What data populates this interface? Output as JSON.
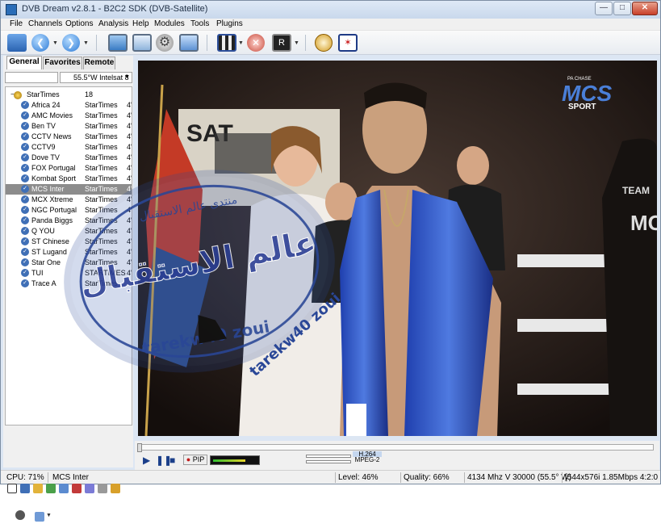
{
  "window": {
    "title": "DVB Dream v2.8.1 - B2C2 SDK (DVB-Satellite)",
    "minimize": "—",
    "maximize": "□",
    "close": "✕"
  },
  "menu": [
    "File",
    "Channels",
    "Options",
    "Analysis",
    "Help",
    "Modules",
    "Tools",
    "Plugins"
  ],
  "toolbar": {
    "icons": [
      "folder-open-icon",
      "back-icon",
      "forward-icon",
      "monitor-icon",
      "window-icon",
      "settings-gears-icon",
      "screen-icon",
      "clapperboard-icon",
      "record-stop-icon",
      "tv-output-icon",
      "timer-clock-icon",
      "radar-icon"
    ]
  },
  "tabs": [
    "General",
    "Favorites",
    "Remote"
  ],
  "satellite": {
    "selected": "55.5°W Intelsat 8"
  },
  "channel_list": {
    "group": {
      "name": "StarTimes",
      "count": "18"
    },
    "rows": [
      {
        "name": "Africa 24",
        "provider": "StarTimes",
        "num": "4'"
      },
      {
        "name": "AMC Movies",
        "provider": "StarTimes",
        "num": "4'"
      },
      {
        "name": "Ben TV",
        "provider": "StarTimes",
        "num": "4'"
      },
      {
        "name": "CCTV News",
        "provider": "StarTimes",
        "num": "4'"
      },
      {
        "name": "CCTV9",
        "provider": "StarTimes",
        "num": "4'"
      },
      {
        "name": "Dove TV",
        "provider": "StarTimes",
        "num": "4'"
      },
      {
        "name": "FOX Portugal",
        "provider": "StarTimes",
        "num": "4'"
      },
      {
        "name": "Kombat Sport",
        "provider": "StarTimes",
        "num": "4'"
      },
      {
        "name": "MCS Inter",
        "provider": "StarTimes",
        "num": "4'",
        "selected": true
      },
      {
        "name": "MCX Xtreme",
        "provider": "StarTimes",
        "num": "4'"
      },
      {
        "name": "NGC Portugal",
        "provider": "StarTimes",
        "num": "4'"
      },
      {
        "name": "Panda Biggs",
        "provider": "StarTimes",
        "num": "4'"
      },
      {
        "name": "Q YOU",
        "provider": "StarTimes",
        "num": "4'"
      },
      {
        "name": "ST Chinese",
        "provider": "StarTimes",
        "num": "4'"
      },
      {
        "name": "ST Lugand",
        "provider": "StarTimes",
        "num": "4'"
      },
      {
        "name": "Star One",
        "provider": "StarTimes",
        "num": "4'"
      },
      {
        "name": "TUI",
        "provider": "STARTIMES",
        "num": "4'"
      },
      {
        "name": "Trace A",
        "provider": "StarTimes",
        "num": ""
      }
    ]
  },
  "video": {
    "channel_logo": "MCS",
    "channel_logo_sub": "SPORT",
    "logo_top": "PA CHASE",
    "banner_text": "SAT",
    "shirt_text": "TEAM",
    "shirt_text2": "MC"
  },
  "watermark": {
    "arabic_top": "منتدى عالم الاستقبال",
    "arabic_main": "عالم الاستقبال",
    "signature": "tarekw40 zoui",
    "signature2": "tarekw40 zoui"
  },
  "controls": {
    "pip": "PIP",
    "codec_video": "H.264",
    "codec_audio": "MPEG-2"
  },
  "status": {
    "cpu": "CPU: 71%",
    "channel": "MCS Inter",
    "level": "Level: 46%",
    "quality": "Quality: 66%",
    "tuning": "4134 Mhz  V  30000  (55.5° W)",
    "stream": "[544x576i  1.85Mbps 4:2:0"
  }
}
